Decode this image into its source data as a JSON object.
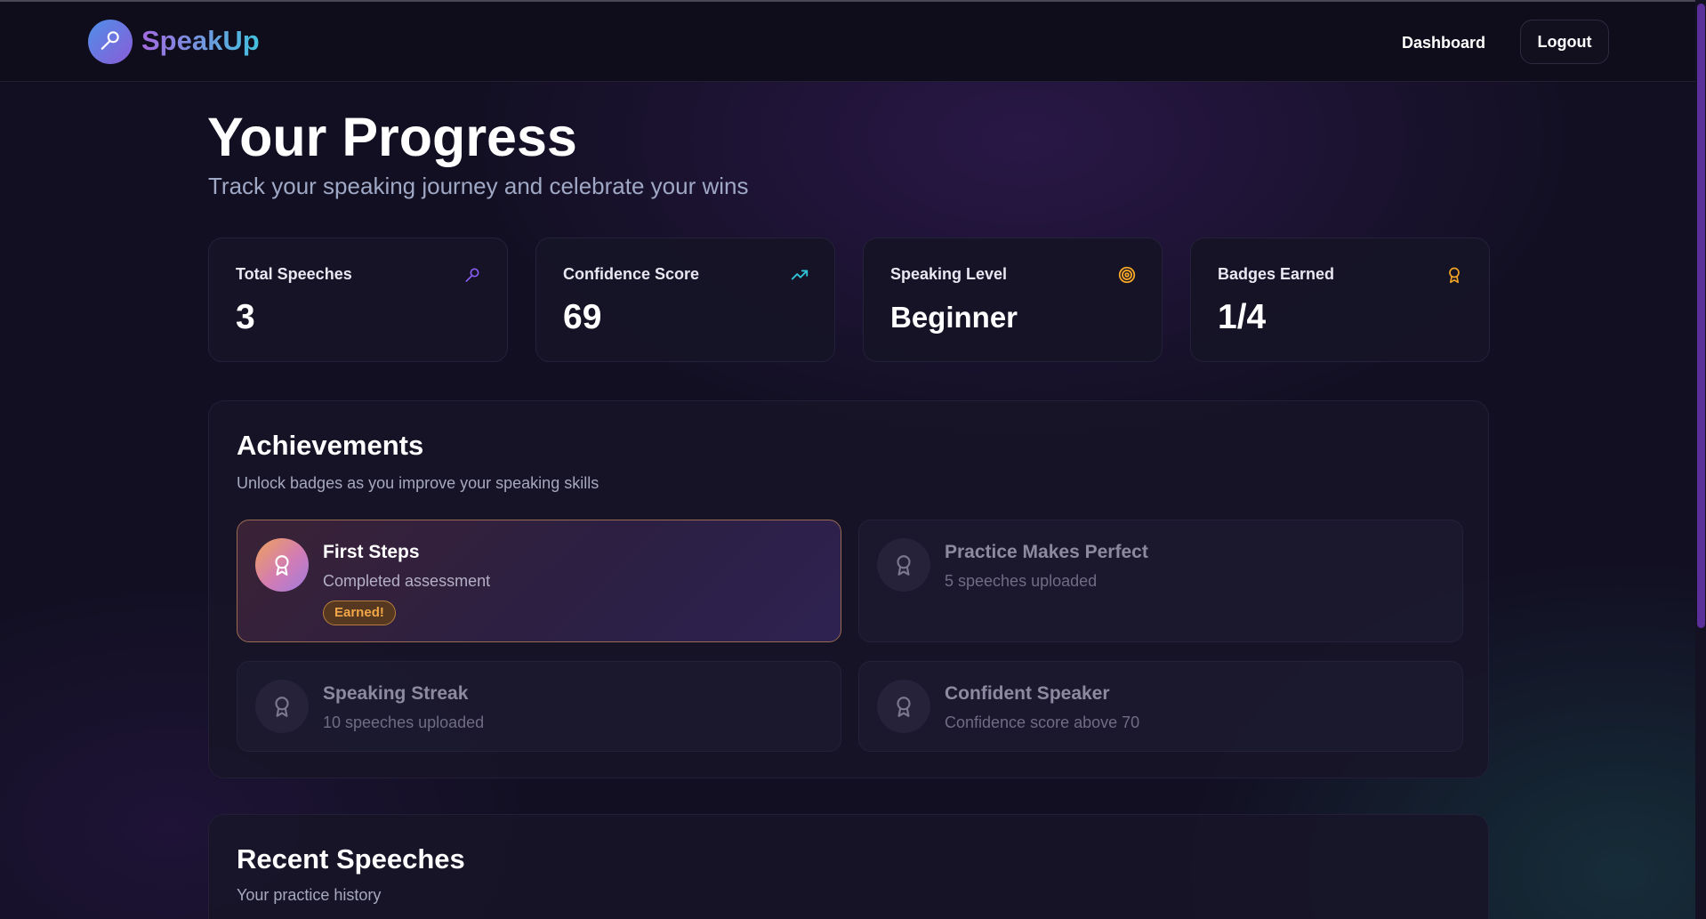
{
  "app": {
    "name": "SpeakUp",
    "logo_icon": "microphone-icon"
  },
  "nav": {
    "dashboard_label": "Dashboard",
    "logout_label": "Logout"
  },
  "page": {
    "title": "Your Progress",
    "subtitle": "Track your speaking journey and celebrate your wins"
  },
  "stats": [
    {
      "label": "Total Speeches",
      "value": "3",
      "icon": "microphone-icon",
      "icon_color": "#8b5cf6"
    },
    {
      "label": "Confidence Score",
      "value": "69",
      "icon": "trending-up-icon",
      "icon_color": "#2ec4d6"
    },
    {
      "label": "Speaking Level",
      "value": "Beginner",
      "icon": "target-icon",
      "icon_color": "#f5a524"
    },
    {
      "label": "Badges Earned",
      "value": "1/4",
      "icon": "award-icon",
      "icon_color": "#f5a524"
    }
  ],
  "achievements": {
    "title": "Achievements",
    "subtitle": "Unlock badges as you improve your speaking skills",
    "badges": [
      {
        "title": "First Steps",
        "description": "Completed assessment",
        "earned": true,
        "earned_label": "Earned!",
        "icon": "award-icon"
      },
      {
        "title": "Practice Makes Perfect",
        "description": "5 speeches uploaded",
        "earned": false,
        "icon": "award-icon"
      },
      {
        "title": "Speaking Streak",
        "description": "10 speeches uploaded",
        "earned": false,
        "icon": "award-icon"
      },
      {
        "title": "Confident Speaker",
        "description": "Confidence score above 70",
        "earned": false,
        "icon": "award-icon"
      }
    ]
  },
  "recent_speeches": {
    "title": "Recent Speeches",
    "subtitle": "Your practice history"
  },
  "colors": {
    "background": "#120f22",
    "navbar": "#0f0d1c",
    "accent_purple": "#8b5cf6",
    "accent_cyan": "#2ec4d6",
    "accent_orange": "#f5a524"
  }
}
